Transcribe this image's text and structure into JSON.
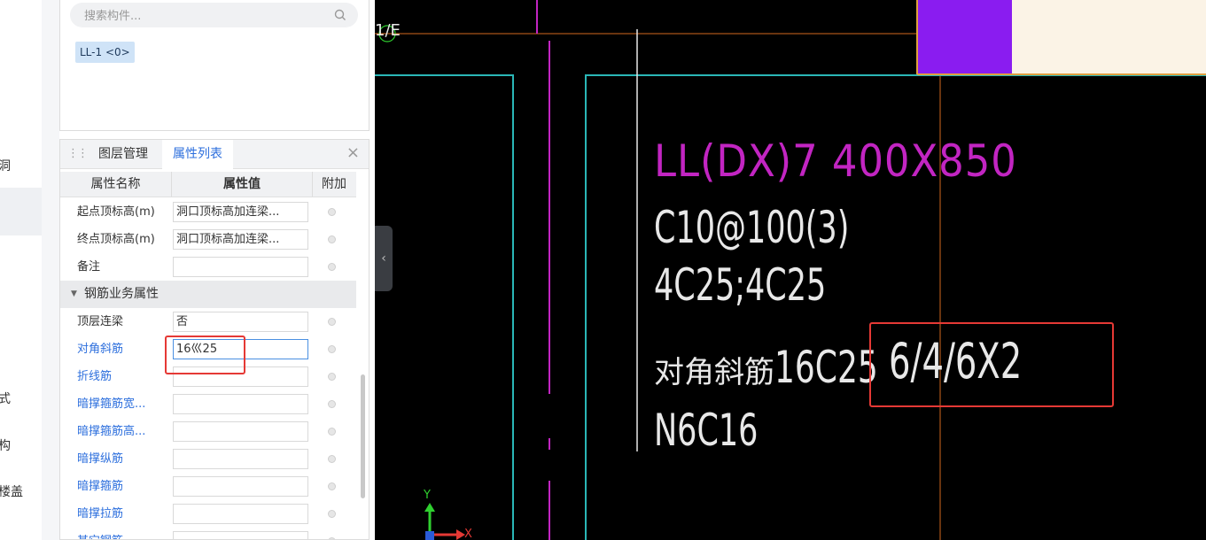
{
  "left_strip": {
    "items": [
      "洞",
      "式",
      "构",
      "楼盖"
    ]
  },
  "component_search": {
    "placeholder": "搜索构件...",
    "tag": "LL-1 <0>"
  },
  "property_panel": {
    "tabs": [
      {
        "label": "图层管理",
        "active": false
      },
      {
        "label": "属性列表",
        "active": true
      }
    ],
    "columns": {
      "name": "属性名称",
      "value": "属性值",
      "extra": "附加"
    },
    "rows": [
      {
        "name": "起点顶标高(m)",
        "value": "洞口顶标高加连梁...",
        "blue": false
      },
      {
        "name": "终点顶标高(m)",
        "value": "洞口顶标高加连梁...",
        "blue": false
      },
      {
        "name": "备注",
        "value": "",
        "blue": false
      }
    ],
    "section": {
      "title": "钢筋业务属性"
    },
    "section_rows": [
      {
        "name": "顶层连梁",
        "value": "否",
        "blue": false
      },
      {
        "name": "对角斜筋",
        "value": "16⼮25",
        "blue": true,
        "active": true
      },
      {
        "name": "折线筋",
        "value": "",
        "blue": true
      },
      {
        "name": "暗撑箍筋宽...",
        "value": "",
        "blue": true
      },
      {
        "name": "暗撑箍筋高...",
        "value": "",
        "blue": true
      },
      {
        "name": "暗撑纵筋",
        "value": "",
        "blue": true
      },
      {
        "name": "暗撑箍筋",
        "value": "",
        "blue": true
      },
      {
        "name": "暗撑拉筋",
        "value": "",
        "blue": true
      },
      {
        "name": "其它钢筋",
        "value": "",
        "blue": true
      }
    ]
  },
  "cad": {
    "axis_label": "1/E",
    "beam_title": "LL(DX)7 400X850",
    "stirrup": "C10@100(3)",
    "long_bars": "4C25;4C25",
    "diag_label_cn": "对角斜筋",
    "diag_label_code": "16C25",
    "diag_spec": "6/4/6X2",
    "side_bars": "N6C16",
    "ucs_y": "Y",
    "ucs_x": "X",
    "colors": {
      "magenta": "#c225c2",
      "cyan": "#2ab7b7",
      "purple_fill": "#8a1cf0",
      "highlight": "#e53935"
    }
  }
}
